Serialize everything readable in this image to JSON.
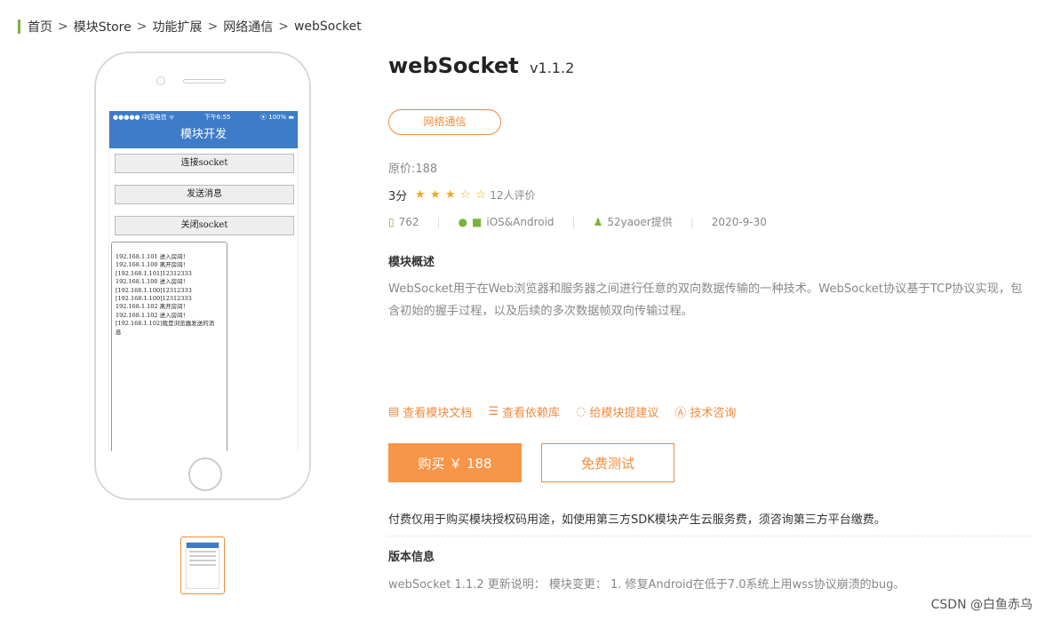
{
  "breadcrumb": {
    "home": "首页",
    "store": "模块Store",
    "category": "功能扩展",
    "subcategory": "网络通信",
    "current": "webSocket",
    "separator": ">",
    "accent_color": "#7ab33a"
  },
  "phone_screen": {
    "status_left": "●●●●● 中国电信 ᯤ",
    "status_time": "下午6:55",
    "status_right": "⦿ 100% ▬",
    "nav_title": "模块开发",
    "buttons": [
      "连接socket",
      "发送消息",
      "关闭socket"
    ],
    "log_lines": [
      "192.168.1.101 进入房间！",
      "192.168.1.100 离开房间！",
      "[192.168.1.101]12312333",
      "192.168.1.100 进入房间！",
      "[192.168.1.100]12312333",
      "[192.168.1.100]12312333",
      "192.168.1.102 离开房间！",
      "192.168.1.102 进入房间！",
      "[192.168.1.102]我是浏览器发送的消",
      "息"
    ]
  },
  "product": {
    "name": "webSocket",
    "version": "v1.1.2",
    "tag": "网络通信",
    "original_price": "原价:188",
    "score": "3分",
    "rating_stars": 3,
    "rating_max": 5,
    "reviews": "12人评价",
    "downloads": "762",
    "platform": "iOS&Android",
    "provider": "52yaoer提供",
    "date": "2020-9-30"
  },
  "overview": {
    "heading": "模块概述",
    "text": "WebSocket用于在Web浏览器和服务器之间进行任意的双向数据传输的一种技术。WebSocket协议基于TCP协议实现，包含初始的握手过程，以及后续的多次数据帧双向传输过程。"
  },
  "links": {
    "docs": "查看模块文档",
    "deps": "查看依赖库",
    "suggest": "给模块提建议",
    "consult": "技术咨询"
  },
  "actions": {
    "buy": "购买 ￥ 188",
    "trial": "免费测试"
  },
  "notice": "付费仅用于购买模块授权码用途，如使用第三方SDK模块产生云服务费，须咨询第三方平台缴费。",
  "version_info": {
    "heading": "版本信息",
    "text": "webSocket 1.1.2 更新说明： 模块变更： 1. 修复Android在低于7.0系统上用wss协议崩溃的bug。"
  },
  "watermark": "CSDN @白鱼赤乌",
  "colors": {
    "accent_orange": "#f08b3d",
    "buy_button": "#f79548",
    "app_blue": "#3d7cc9",
    "green": "#7ab33a"
  }
}
